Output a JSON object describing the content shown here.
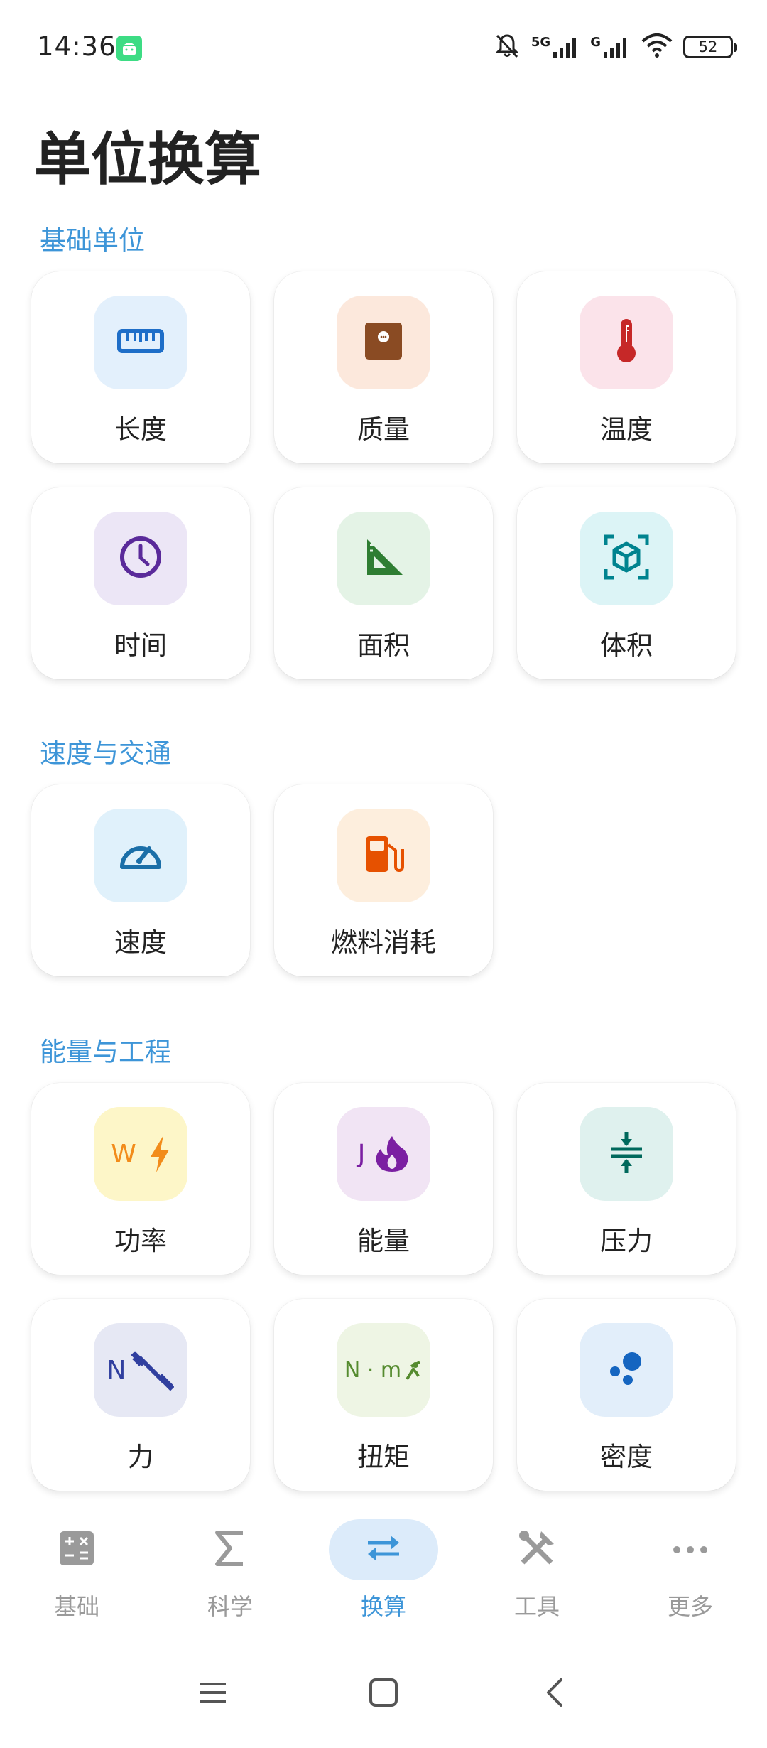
{
  "status_bar": {
    "time": "14:36",
    "network_label_1": "5G",
    "network_label_2": "G",
    "battery_level": "52"
  },
  "page": {
    "title": "单位换算"
  },
  "sections": [
    {
      "title": "基础单位",
      "items": [
        {
          "label": "长度",
          "icon": "ruler-icon",
          "tile_color": "#e3f0fc",
          "icon_color": "#1e6ec8"
        },
        {
          "label": "质量",
          "icon": "scale-icon",
          "tile_color": "#fce8dc",
          "icon_color": "#8a4b23"
        },
        {
          "label": "温度",
          "icon": "thermometer-icon",
          "tile_color": "#fbe3ea",
          "icon_color": "#c62828"
        },
        {
          "label": "时间",
          "icon": "clock-icon",
          "tile_color": "#ece6f6",
          "icon_color": "#5a2a9a"
        },
        {
          "label": "面积",
          "icon": "set-square-icon",
          "tile_color": "#e4f3e6",
          "icon_color": "#2e7d32"
        },
        {
          "label": "体积",
          "icon": "cube-icon",
          "tile_color": "#dcf4f6",
          "icon_color": "#00838f"
        }
      ]
    },
    {
      "title": "速度与交通",
      "items": [
        {
          "label": "速度",
          "icon": "speedometer-icon",
          "tile_color": "#e0f1fb",
          "icon_color": "#1b6fa8"
        },
        {
          "label": "燃料消耗",
          "icon": "fuel-pump-icon",
          "tile_color": "#fdeedd",
          "icon_color": "#e65100"
        }
      ]
    },
    {
      "title": "能量与工程",
      "items": [
        {
          "label": "功率",
          "icon": "watt-bolt-icon",
          "icon_text": "W",
          "tile_color": "#fdf6c8",
          "icon_color": "#f28c1b"
        },
        {
          "label": "能量",
          "icon": "joule-flame-icon",
          "icon_text": "J",
          "tile_color": "#f1e4f4",
          "icon_color": "#7b1fa2"
        },
        {
          "label": "压力",
          "icon": "compress-icon",
          "tile_color": "#dff1ee",
          "icon_color": "#00695c"
        },
        {
          "label": "力",
          "icon": "newton-dumbbell-icon",
          "icon_text": "N",
          "tile_color": "#e6e8f4",
          "icon_color": "#303f9f"
        },
        {
          "label": "扭矩",
          "icon": "newton-meter-icon",
          "icon_text": "N · m",
          "tile_color": "#eef5e4",
          "icon_color": "#558b2f"
        },
        {
          "label": "密度",
          "icon": "molecules-icon",
          "tile_color": "#e2eefa",
          "icon_color": "#1565c0"
        }
      ]
    }
  ],
  "bottom_nav": {
    "items": [
      {
        "label": "基础",
        "icon": "calculator-icon"
      },
      {
        "label": "科学",
        "icon": "sigma-icon"
      },
      {
        "label": "换算",
        "icon": "swap-arrows-icon",
        "active": true
      },
      {
        "label": "工具",
        "icon": "tools-icon"
      },
      {
        "label": "更多",
        "icon": "more-dots-icon"
      }
    ]
  },
  "colors": {
    "accent": "#3d95d8",
    "active_nav_bg": "#dcebfa",
    "inactive_nav": "#9a9a9a"
  }
}
